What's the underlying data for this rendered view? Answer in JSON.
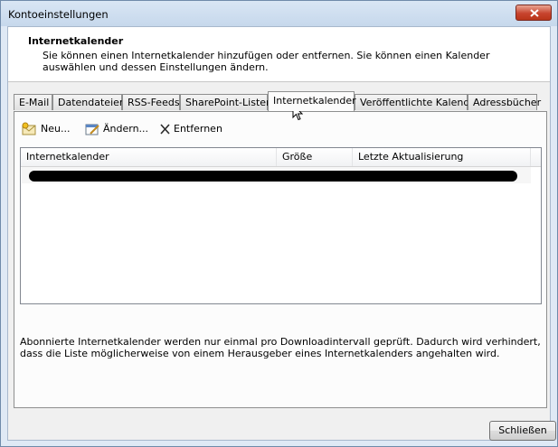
{
  "window": {
    "title": "Kontoeinstellungen"
  },
  "header": {
    "title": "Internetkalender",
    "description": "Sie können einen Internetkalender hinzufügen oder entfernen. Sie können einen Kalender auswählen und dessen Einstellungen ändern."
  },
  "tabs": [
    {
      "label": "E-Mail"
    },
    {
      "label": "Datendateien"
    },
    {
      "label": "RSS-Feeds"
    },
    {
      "label": "SharePoint-Listen"
    },
    {
      "label": "Internetkalender",
      "active": true
    },
    {
      "label": "Veröffentlichte Kalender"
    },
    {
      "label": "Adressbücher"
    }
  ],
  "toolbar": {
    "new_label": "Neu...",
    "change_label": "Ändern...",
    "remove_label": "Entfernen"
  },
  "list": {
    "columns": [
      "Internetkalender",
      "Größe",
      "Letzte Aktualisierung"
    ]
  },
  "footnote": "Abonnierte Internetkalender werden nur einmal pro Downloadintervall geprüft. Dadurch wird verhindert, dass die Liste möglicherweise von einem Herausgeber eines Internetkalenders angehalten wird.",
  "buttons": {
    "close_label": "Schließen"
  }
}
